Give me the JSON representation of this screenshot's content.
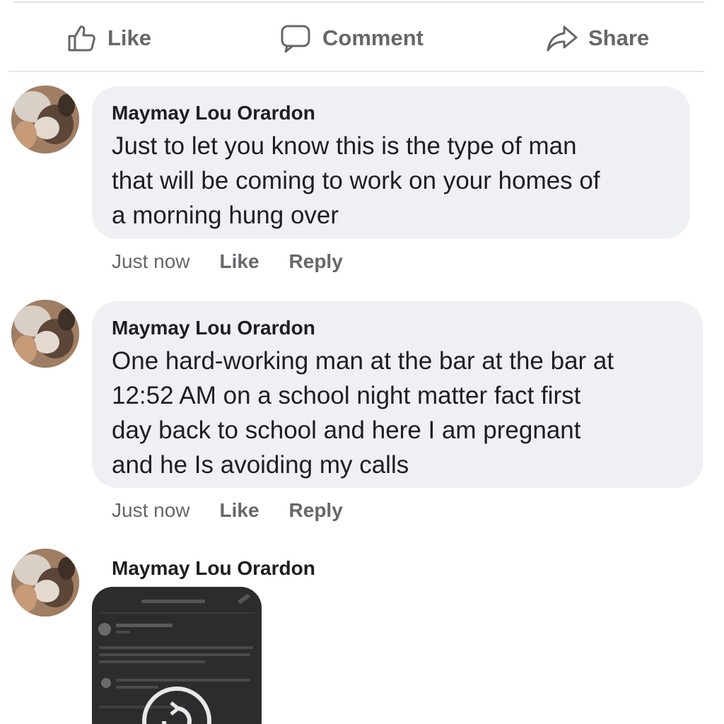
{
  "actions": {
    "like_label": "Like",
    "comment_label": "Comment",
    "share_label": "Share",
    "icon_color": "#65676b"
  },
  "comments": [
    {
      "author": "Maymay Lou Orardon",
      "lines": [
        "Just to let you know this is the type of man",
        "that will be coming to work on your homes of",
        "a morning hung over"
      ],
      "time": "Just now",
      "like_label": "Like",
      "reply_label": "Reply"
    },
    {
      "author": "Maymay Lou Orardon",
      "lines": [
        "One hard-working man at the bar at the bar at",
        "12:52 AM on a school night matter fact first",
        "day back to school and here I am pregnant",
        "and he Is avoiding my calls"
      ],
      "time": "Just now",
      "like_label": "Like",
      "reply_label": "Reply"
    },
    {
      "author": "Maymay Lou Orardon"
    }
  ],
  "colors": {
    "bubble": "#eff0f4",
    "secondary_text": "#65676b",
    "primary_text": "#1c1e21",
    "attachment_bg": "#2c2c2e"
  }
}
